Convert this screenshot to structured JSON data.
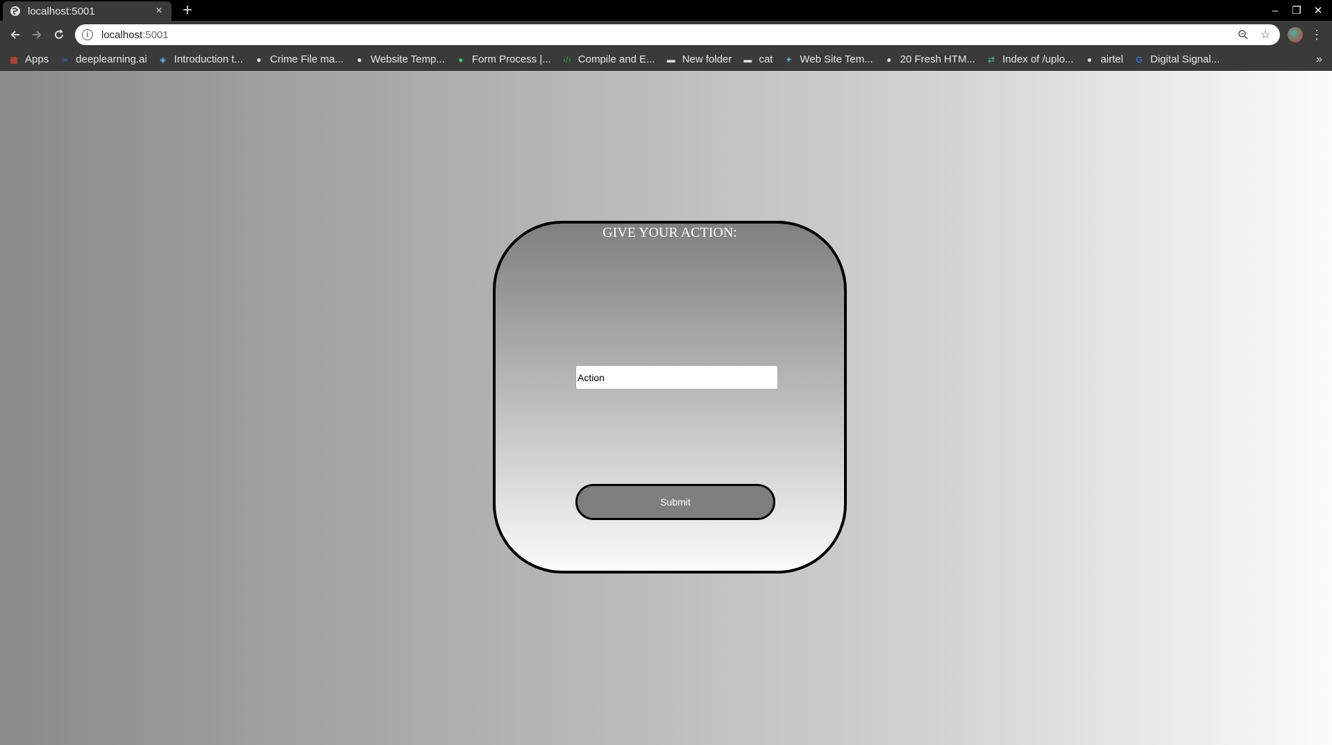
{
  "browser": {
    "tab_title": "localhost:5001",
    "tab_close": "×",
    "new_tab": "+",
    "url_host": "localhost",
    "url_port": ":5001",
    "window_controls": [
      "–",
      "❐",
      "✕"
    ],
    "bookmarks": [
      {
        "label": "Apps",
        "icon": "apps-grid-icon",
        "color": "#e74c3c"
      },
      {
        "label": "deeplearning.ai",
        "icon": "infinity-icon",
        "color": "#3a7bd5"
      },
      {
        "label": "Introduction t...",
        "icon": "cube-icon",
        "color": "#5dade2"
      },
      {
        "label": "Crime File ma...",
        "icon": "globe-icon",
        "color": "#dddddd"
      },
      {
        "label": "Website Temp...",
        "icon": "globe-icon",
        "color": "#dddddd"
      },
      {
        "label": "Form Process |...",
        "icon": "leaf-icon",
        "color": "#2ecc71"
      },
      {
        "label": "Compile and E...",
        "icon": "code-icon",
        "color": "#27ae60"
      },
      {
        "label": "New folder",
        "icon": "folder-icon",
        "color": "#dddddd"
      },
      {
        "label": "cat",
        "icon": "folder-icon",
        "color": "#dddddd"
      },
      {
        "label": "Web Site Tem...",
        "icon": "bird-icon",
        "color": "#5dade2"
      },
      {
        "label": "20 Fresh HTM...",
        "icon": "globe-icon",
        "color": "#dddddd"
      },
      {
        "label": "Index of /uplo...",
        "icon": "arrows-icon",
        "color": "#48c9b0"
      },
      {
        "label": "airtel",
        "icon": "globe-icon",
        "color": "#dddddd"
      },
      {
        "label": "Digital Signal...",
        "icon": "google-g-icon",
        "color": "#4285f4"
      }
    ],
    "bookmarks_more": "»"
  },
  "form": {
    "heading": "GIVE YOUR ACTION:",
    "action_value": "Action",
    "submit_label": "Submit"
  }
}
